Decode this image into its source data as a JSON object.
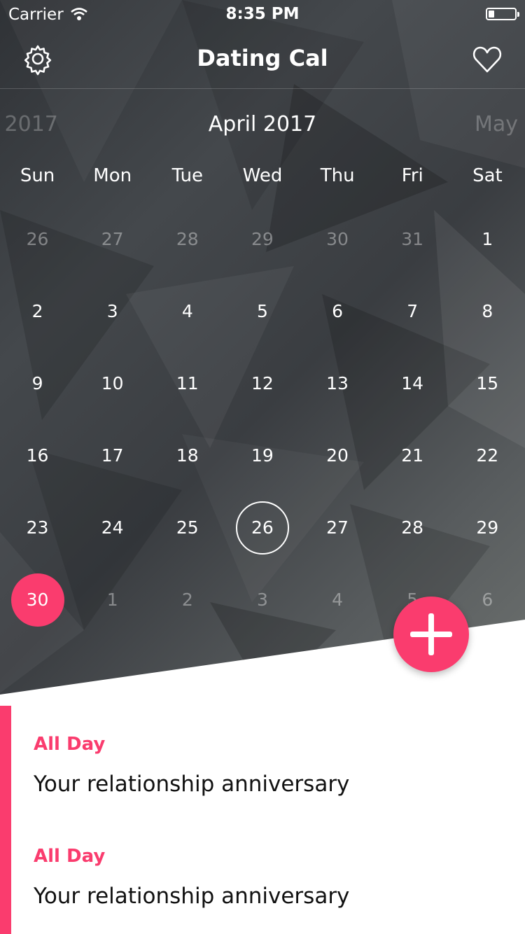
{
  "status_bar": {
    "carrier": "Carrier",
    "time": "8:35 PM"
  },
  "nav": {
    "title": "Dating Cal",
    "left_icon": "gear-icon",
    "right_icon": "heart-icon"
  },
  "months": {
    "prev": "n 2017",
    "current": "April 2017",
    "next": "May"
  },
  "weekdays": [
    "Sun",
    "Mon",
    "Tue",
    "Wed",
    "Thu",
    "Fri",
    "Sat"
  ],
  "calendar": {
    "days": [
      {
        "label": "26",
        "muted": true
      },
      {
        "label": "27",
        "muted": true
      },
      {
        "label": "28",
        "muted": true
      },
      {
        "label": "29",
        "muted": true
      },
      {
        "label": "30",
        "muted": true
      },
      {
        "label": "31",
        "muted": true
      },
      {
        "label": "1",
        "muted": false
      },
      {
        "label": "2",
        "muted": false
      },
      {
        "label": "3",
        "muted": false
      },
      {
        "label": "4",
        "muted": false
      },
      {
        "label": "5",
        "muted": false
      },
      {
        "label": "6",
        "muted": false
      },
      {
        "label": "7",
        "muted": false
      },
      {
        "label": "8",
        "muted": false
      },
      {
        "label": "9",
        "muted": false
      },
      {
        "label": "10",
        "muted": false
      },
      {
        "label": "11",
        "muted": false
      },
      {
        "label": "12",
        "muted": false
      },
      {
        "label": "13",
        "muted": false
      },
      {
        "label": "14",
        "muted": false
      },
      {
        "label": "15",
        "muted": false
      },
      {
        "label": "16",
        "muted": false
      },
      {
        "label": "17",
        "muted": false
      },
      {
        "label": "18",
        "muted": false
      },
      {
        "label": "19",
        "muted": false
      },
      {
        "label": "20",
        "muted": false
      },
      {
        "label": "21",
        "muted": false
      },
      {
        "label": "22",
        "muted": false
      },
      {
        "label": "23",
        "muted": false
      },
      {
        "label": "24",
        "muted": false
      },
      {
        "label": "25",
        "muted": false
      },
      {
        "label": "26",
        "muted": false,
        "selected": true
      },
      {
        "label": "27",
        "muted": false
      },
      {
        "label": "28",
        "muted": false
      },
      {
        "label": "29",
        "muted": false
      },
      {
        "label": "30",
        "muted": false,
        "today": true
      },
      {
        "label": "1",
        "muted": true
      },
      {
        "label": "2",
        "muted": true
      },
      {
        "label": "3",
        "muted": true
      },
      {
        "label": "4",
        "muted": true
      },
      {
        "label": "5",
        "muted": true
      },
      {
        "label": "6",
        "muted": true
      }
    ]
  },
  "add_button": {
    "icon": "plus-icon"
  },
  "events": [
    {
      "when": "All Day",
      "title": "Your relationship anniversary"
    },
    {
      "when": "All Day",
      "title": "Your relationship anniversary"
    }
  ],
  "colors": {
    "accent": "#fa3c6e",
    "text_dark": "#111111",
    "background": "#ffffff"
  }
}
